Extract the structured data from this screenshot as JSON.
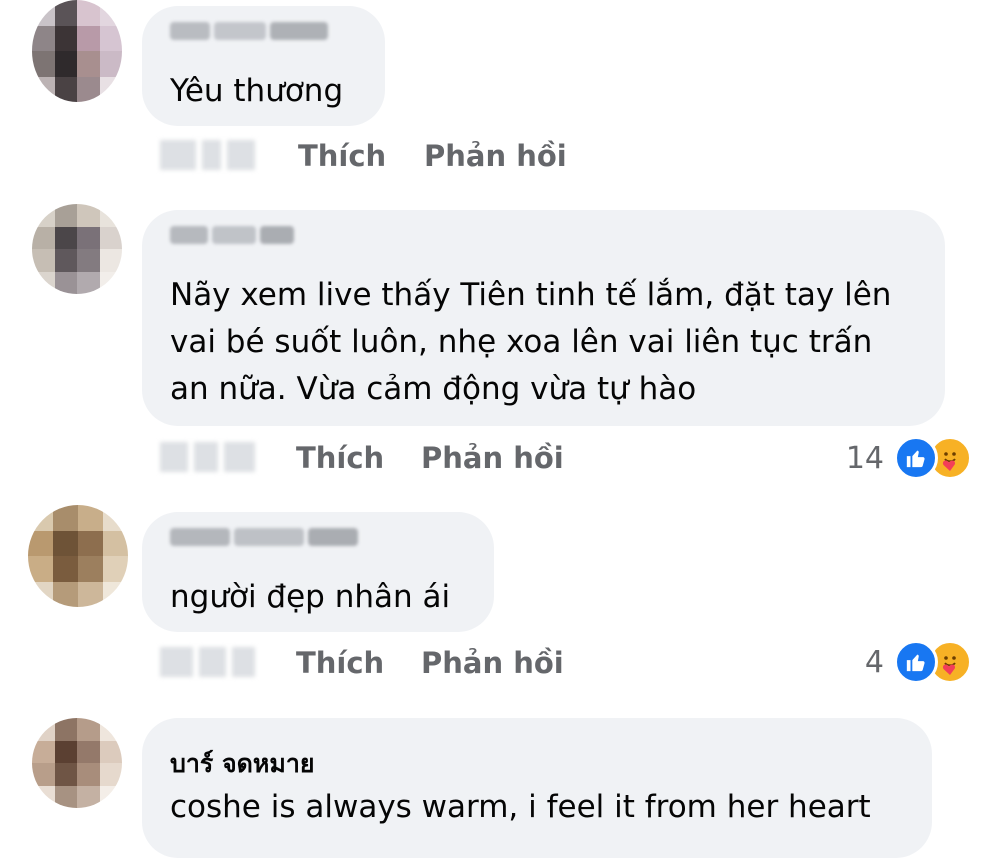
{
  "comments": [
    {
      "text_lines": [
        "Yêu thương"
      ],
      "actions": {
        "like": "Thích",
        "reply": "Phản hồi"
      }
    },
    {
      "text_lines": [
        "Nãy xem live thấy Tiên tinh tế lắm, đặt tay lên",
        "vai bé suốt luôn, nhẹ xoa lên vai liên tục trấn",
        "an nữa. Vừa cảm động vừa tự hào"
      ],
      "actions": {
        "like": "Thích",
        "reply": "Phản hồi"
      },
      "reaction_count": "14",
      "reaction_icons": [
        "like-icon",
        "care-icon"
      ]
    },
    {
      "text_lines": [
        "người đẹp nhân ái"
      ],
      "actions": {
        "like": "Thích",
        "reply": "Phản hồi"
      },
      "reaction_count": "4",
      "reaction_icons": [
        "like-icon",
        "care-icon"
      ]
    },
    {
      "author": "บาร์ จดหมาย",
      "text_lines": [
        "coshe is always warm, i feel it from her heart"
      ]
    }
  ],
  "colors": {
    "bubble": "#f0f2f5",
    "action_text": "#65676b",
    "like_blue": "#1877f2",
    "care_yellow": "#f7b125"
  }
}
